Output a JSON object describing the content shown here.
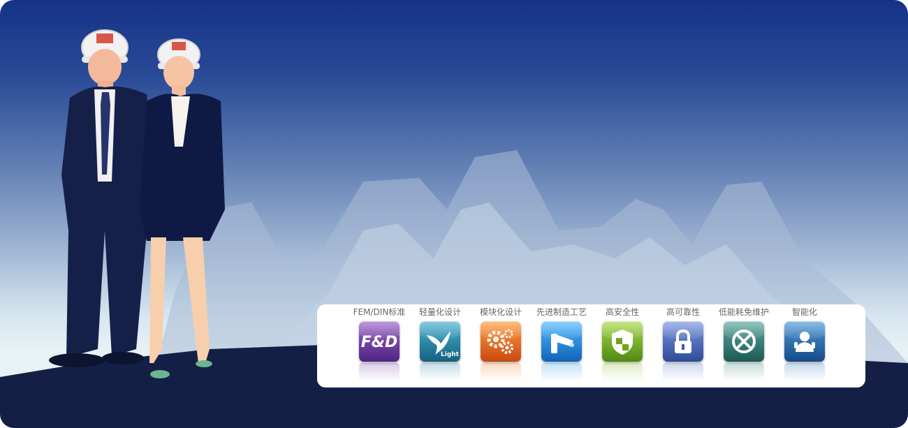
{
  "features": [
    {
      "label": "FEM/DIN标准",
      "icon": "fd-logo-icon",
      "color": "#7b46a8",
      "color2": "#4f2483",
      "icon_text": "F&D"
    },
    {
      "label": "轻量化设计",
      "icon": "bird-light-icon",
      "color": "#2c8fb0",
      "color2": "#15607f",
      "icon_text": "Light"
    },
    {
      "label": "模块化设计",
      "icon": "gears-icon",
      "color": "#f07a22",
      "color2": "#c94a10",
      "icon_text": ""
    },
    {
      "label": "先进制造工艺",
      "icon": "welding-tool-icon",
      "color": "#2a9ae6",
      "color2": "#1063b8",
      "icon_text": ""
    },
    {
      "label": "高安全性",
      "icon": "shield-icon",
      "color": "#8cc028",
      "color2": "#4f8a12",
      "icon_text": ""
    },
    {
      "label": "高可靠性",
      "icon": "lock-icon",
      "color": "#5876c8",
      "color2": "#2f4b98",
      "icon_text": ""
    },
    {
      "label": "低能耗免维护",
      "icon": "no-tools-icon",
      "color": "#3d8a82",
      "color2": "#1c5952",
      "icon_text": ""
    },
    {
      "label": "智能化",
      "icon": "person-icon",
      "color": "#2f79b8",
      "color2": "#144a86",
      "icon_text": ""
    }
  ]
}
